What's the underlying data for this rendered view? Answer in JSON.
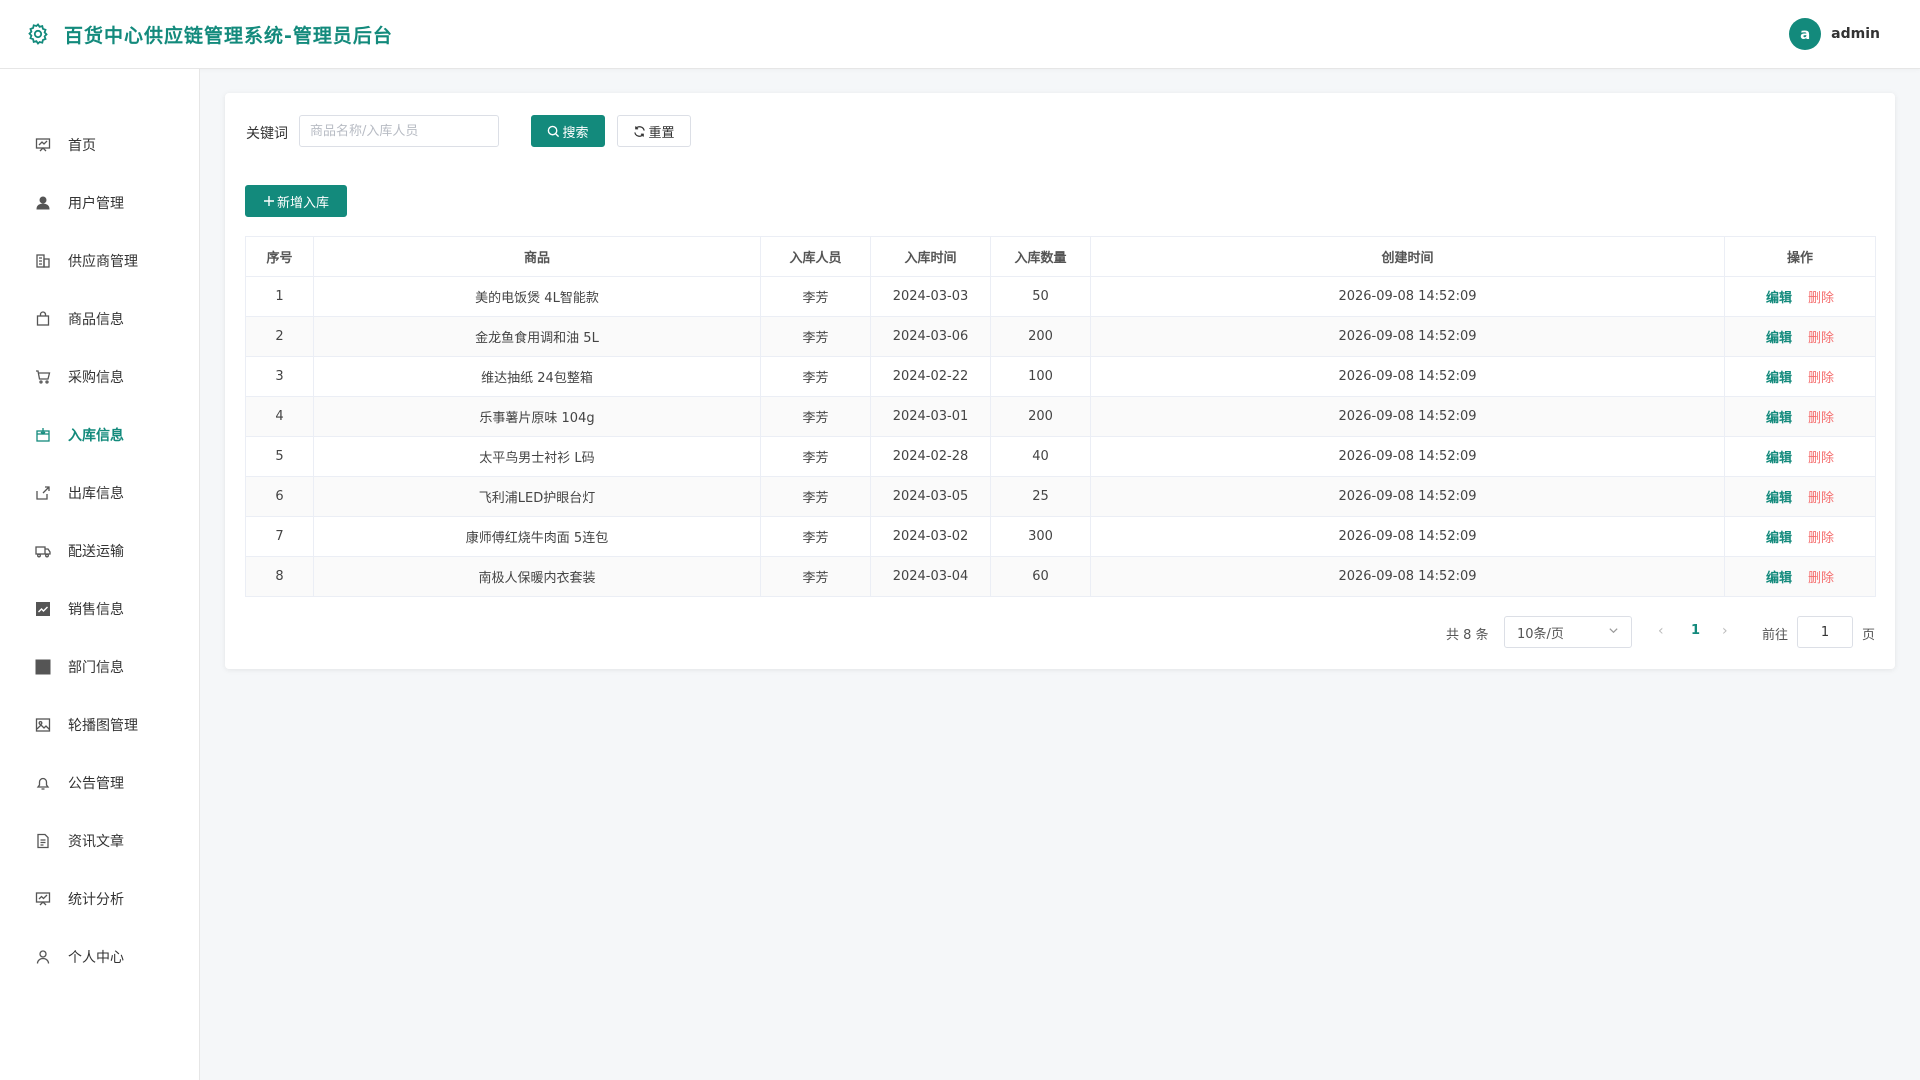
{
  "app": {
    "title": "百货中心供应链管理系统-管理员后台",
    "user_initial": "a",
    "username": "admin",
    "accent": "#138a7c"
  },
  "sidebar": {
    "items": [
      {
        "label": "首页",
        "icon": "home-chart-icon"
      },
      {
        "label": "用户管理",
        "icon": "user-icon"
      },
      {
        "label": "供应商管理",
        "icon": "building-icon"
      },
      {
        "label": "商品信息",
        "icon": "bag-icon"
      },
      {
        "label": "采购信息",
        "icon": "cart-icon"
      },
      {
        "label": "入库信息",
        "icon": "box-in-icon",
        "active": true
      },
      {
        "label": "出库信息",
        "icon": "box-out-icon"
      },
      {
        "label": "配送运输",
        "icon": "truck-icon"
      },
      {
        "label": "销售信息",
        "icon": "trend-chart-icon"
      },
      {
        "label": "部门信息",
        "icon": "grid-icon"
      },
      {
        "label": "轮播图管理",
        "icon": "picture-icon"
      },
      {
        "label": "公告管理",
        "icon": "bell-icon"
      },
      {
        "label": "资讯文章",
        "icon": "document-icon"
      },
      {
        "label": "统计分析",
        "icon": "presentation-icon"
      },
      {
        "label": "个人中心",
        "icon": "person-icon"
      }
    ]
  },
  "search": {
    "label": "关键词",
    "placeholder": "商品名称/入库人员",
    "value": "",
    "search_label": "搜索",
    "reset_label": "重置"
  },
  "toolbar": {
    "add_label": "新增入库"
  },
  "table": {
    "headers": [
      "序号",
      "商品",
      "入库人员",
      "入库时间",
      "入库数量",
      "创建时间",
      "操作"
    ],
    "edit_label": "编辑",
    "delete_label": "删除",
    "rows": [
      [
        "1",
        "美的电饭煲 4L智能款",
        "李芳",
        "2024-03-03",
        "50",
        "2026-09-08 14:52:09"
      ],
      [
        "2",
        "金龙鱼食用调和油 5L",
        "李芳",
        "2024-03-06",
        "200",
        "2026-09-08 14:52:09"
      ],
      [
        "3",
        "维达抽纸 24包整箱",
        "李芳",
        "2024-02-22",
        "100",
        "2026-09-08 14:52:09"
      ],
      [
        "4",
        "乐事薯片原味 104g",
        "李芳",
        "2024-03-01",
        "200",
        "2026-09-08 14:52:09"
      ],
      [
        "5",
        "太平鸟男士衬衫 L码",
        "李芳",
        "2024-02-28",
        "40",
        "2026-09-08 14:52:09"
      ],
      [
        "6",
        "飞利浦LED护眼台灯",
        "李芳",
        "2024-03-05",
        "25",
        "2026-09-08 14:52:09"
      ],
      [
        "7",
        "康师傅红烧牛肉面 5连包",
        "李芳",
        "2024-03-02",
        "300",
        "2026-09-08 14:52:09"
      ],
      [
        "8",
        "南极人保暖内衣套装",
        "李芳",
        "2024-03-04",
        "60",
        "2026-09-08 14:52:09"
      ]
    ]
  },
  "pagination": {
    "total": "共 8 条",
    "page_size": "10条/页",
    "current_page": "1",
    "goto_label": "前往",
    "goto_value": "1",
    "page_suffix": "页"
  }
}
